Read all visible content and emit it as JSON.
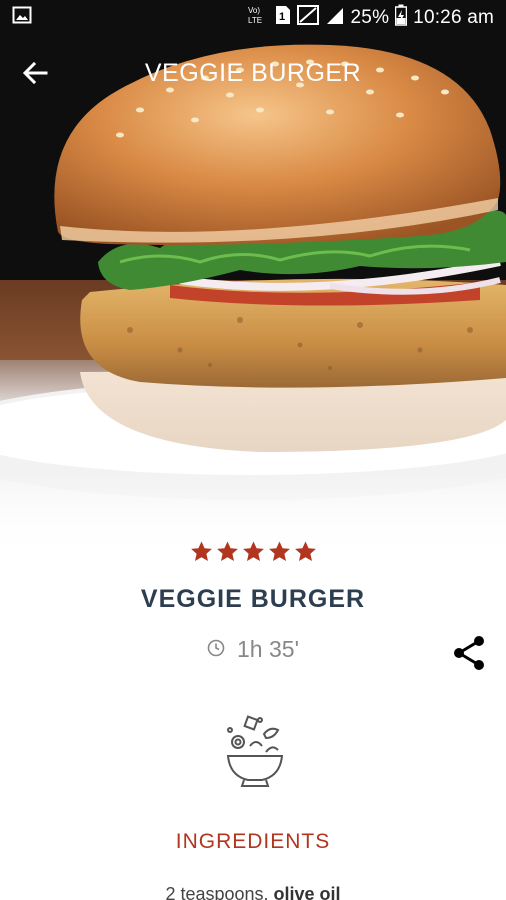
{
  "status_bar": {
    "network_label": "Vo) LTE",
    "sim_slot": "1",
    "battery_percent": "25%",
    "time": "10:26 am"
  },
  "app_bar": {
    "title": "VEGGIE BURGER",
    "back_icon": "arrow-back-icon"
  },
  "recipe": {
    "rating": 5,
    "rating_max": 5,
    "star_color": "#b0361f",
    "title": "VEGGIE BURGER",
    "time_icon": "clock-icon",
    "time": "1h 35'",
    "share_icon": "share-icon"
  },
  "ingredients": {
    "icon": "salad-bowl-icon",
    "heading": "INGREDIENTS",
    "first_item": {
      "amount": "2 teaspoons",
      "name": "olive oil"
    }
  },
  "colors": {
    "accent": "#b0361f",
    "title_text": "#2d3e50",
    "muted_text": "#888888"
  }
}
